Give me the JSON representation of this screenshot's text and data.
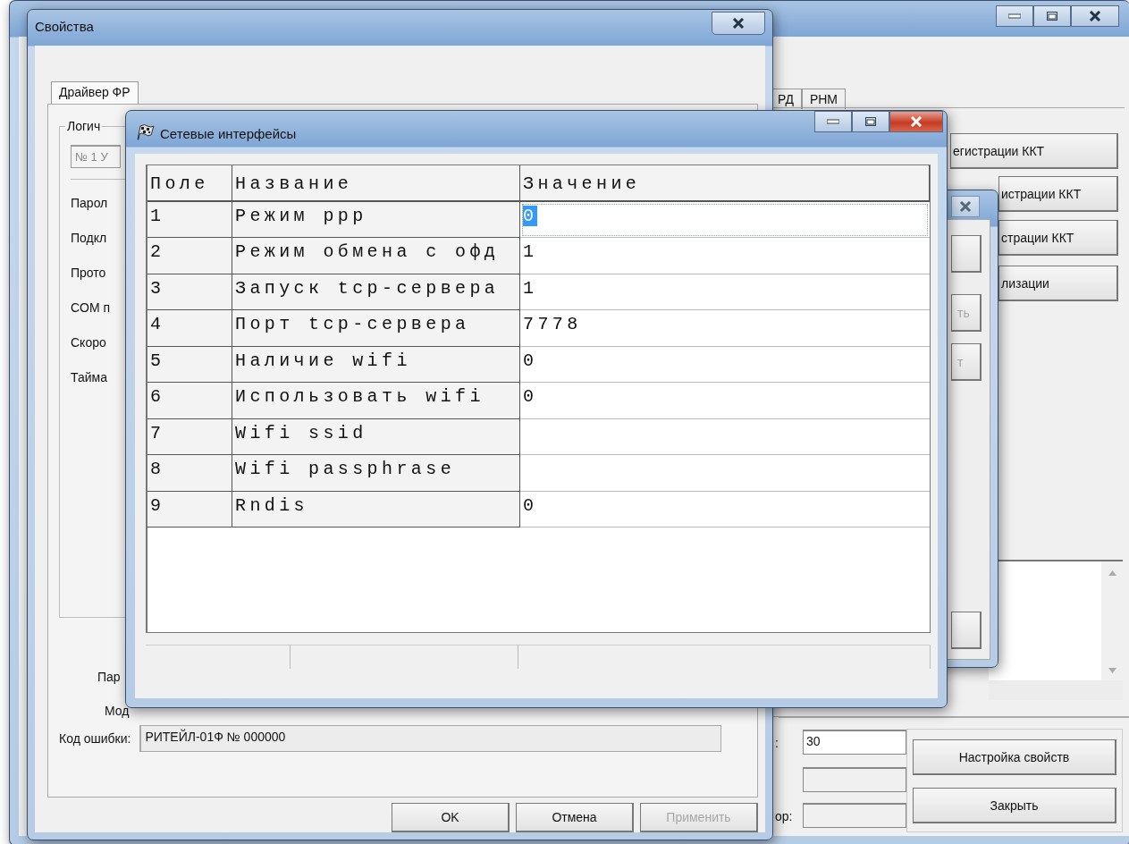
{
  "main_window": {
    "tabs": [
      {
        "label": "РД",
        "selected": false
      },
      {
        "label": "РНМ",
        "selected": false
      }
    ],
    "buttons": [
      "егистрации ККТ",
      "истрации ККТ",
      "страции ККТ",
      "лизации"
    ],
    "fields": [
      {
        "label": ":",
        "value": "30",
        "disabled": false
      },
      {
        "disabled": true
      },
      {
        "label": "ор:",
        "disabled": true
      }
    ],
    "action_buttons": [
      "Настройка свойств",
      "Закрыть"
    ]
  },
  "middle_dialog": {
    "buttons": [
      {
        "label": "ть",
        "disabled": true
      },
      {
        "label": "т",
        "disabled": true
      }
    ]
  },
  "properties_window": {
    "title": "Свойства",
    "tabs": [
      {
        "label": "Драйвер ФР",
        "selected": true
      }
    ],
    "group_label": "Логич",
    "device_field": "№ 1 У",
    "labels": [
      "Парол",
      "Подкл",
      "Прото",
      "COM п",
      "Скоро",
      "Тайма"
    ],
    "lower_labels": [
      "Пар",
      "Мод"
    ],
    "error_code": {
      "label": "Код ошибки:",
      "value": "РИТЕЙЛ-01Ф № 000000"
    },
    "buttons": [
      {
        "label": "OK",
        "disabled": false
      },
      {
        "label": "Отмена",
        "disabled": false
      },
      {
        "label": "Применить",
        "disabled": true
      }
    ]
  },
  "network_window": {
    "title": "Сетевые интерфейсы",
    "columns": [
      "Поле",
      "Название",
      "Значение"
    ],
    "rows": [
      {
        "field": "1",
        "name": "Режим ppp",
        "value": "0",
        "selected": true
      },
      {
        "field": "2",
        "name": "Режим обмена с офд",
        "value": "1",
        "selected": false
      },
      {
        "field": "3",
        "name": "Запуск tcp-сервера",
        "value": "1",
        "selected": false
      },
      {
        "field": "4",
        "name": "Порт tcp-сервера",
        "value": "7778",
        "selected": false
      },
      {
        "field": "5",
        "name": "Наличие wifi",
        "value": "0",
        "selected": false
      },
      {
        "field": "6",
        "name": "Использовать wifi",
        "value": "0",
        "selected": false
      },
      {
        "field": "7",
        "name": "Wifi ssid",
        "selected": false
      },
      {
        "field": "8",
        "name": "Wifi passphrase",
        "selected": false
      },
      {
        "field": "9",
        "name": "Rndis",
        "value": "0",
        "selected": false
      }
    ]
  }
}
